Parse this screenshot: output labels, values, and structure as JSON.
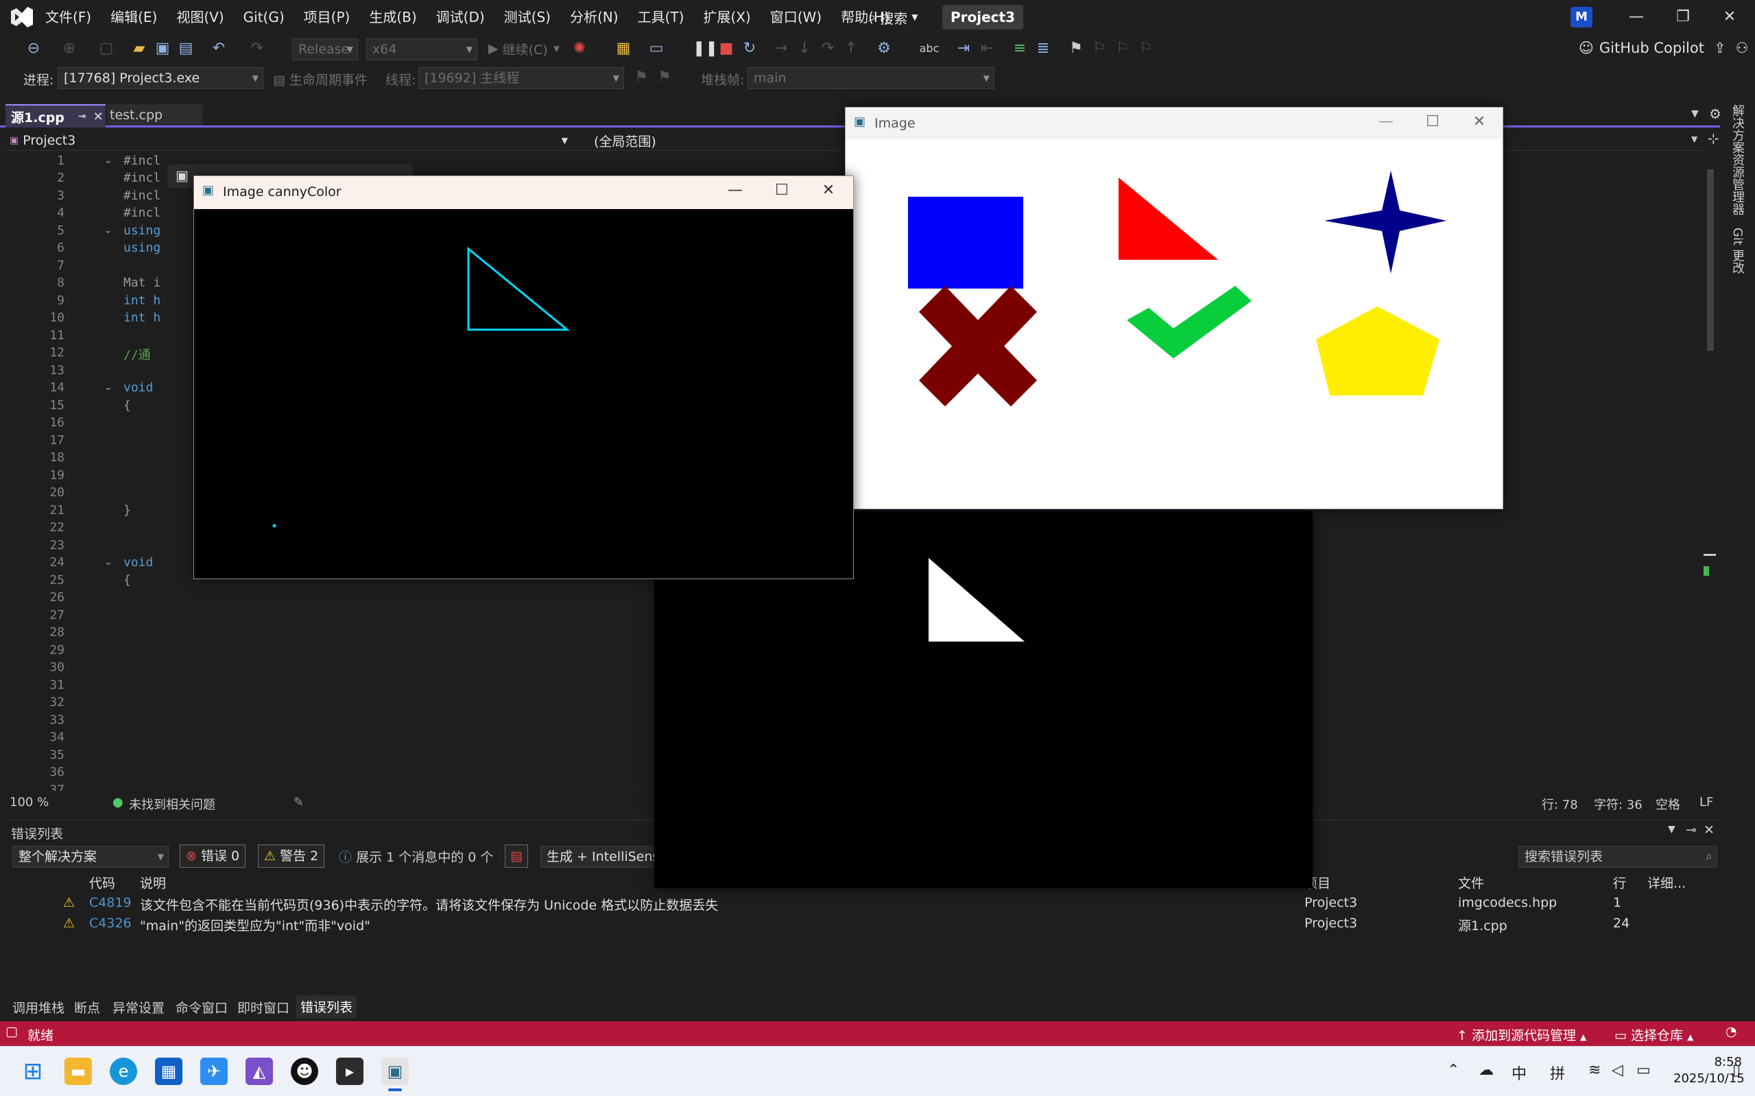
{
  "menubar": {
    "items": [
      "文件(F)",
      "编辑(E)",
      "视图(V)",
      "Git(G)",
      "项目(P)",
      "生成(B)",
      "调试(D)",
      "测试(S)",
      "分析(N)",
      "工具(T)",
      "扩展(X)",
      "窗口(W)",
      "帮助(H)"
    ],
    "search": "搜索",
    "project": "Project3",
    "avatar": "M"
  },
  "toolbar": {
    "config": "Release",
    "platform": "x64",
    "continue": "继续(C)",
    "copilot": "GitHub Copilot"
  },
  "debugbar": {
    "process_label": "进程:",
    "process_value": "[17768] Project3.exe",
    "lifecycle": "生命周期事件",
    "thread_label": "线程:",
    "thread_value": "[19692] 主线程",
    "stack_label": "堆栈帧:",
    "stack_value": "main"
  },
  "tabs": {
    "active": "源1.cpp",
    "inactive": "test.cpp"
  },
  "navbar": {
    "project": "Project3",
    "scope": "(全局范围)"
  },
  "editor": {
    "line_numbers": [
      "1",
      "2",
      "3",
      "4",
      "5",
      "6",
      "7",
      "8",
      "9",
      "10",
      "11",
      "12",
      "13",
      "14",
      "15",
      "16",
      "17",
      "18",
      "19",
      "20",
      "21",
      "22",
      "23",
      "24",
      "25",
      "26",
      "27",
      "28",
      "29",
      "30",
      "31",
      "32",
      "33",
      "34",
      "35",
      "36",
      "37"
    ],
    "code": {
      "l1": "#incl",
      "l2": "#incl",
      "l3": "#incl",
      "l4": "#incl",
      "l5": "using",
      "l6": "using",
      "l8": "Mat i",
      "l9": "int h",
      "l10": "int h",
      "l12": "//通",
      "l14": "void",
      "l15": "{",
      "l21": "}",
      "l24": "void",
      "l25": "{"
    }
  },
  "statusline": {
    "zoom": "100 %",
    "issues": "未找到相关问题",
    "row": "行: 78",
    "col": "字符: 36",
    "spaces": "空格",
    "eol": "LF"
  },
  "side_tabs": [
    "解决方案资源管理器",
    "Git 更改"
  ],
  "errorlist": {
    "title": "错误列表",
    "scope": "整个解决方案",
    "errors": "错误 0",
    "warnings": "警告 2",
    "messages": "展示 1 个消息中的 0 个",
    "build_filter": "生成 + IntelliSense",
    "search_placeholder": "搜索错误列表",
    "headers": {
      "code": "代码",
      "desc": "说明",
      "project": "项目",
      "file": "文件",
      "line": "行",
      "detail": "详细..."
    },
    "rows": [
      {
        "code": "C4819",
        "desc": "该文件包含不能在当前代码页(936)中表示的字符。请将该文件保存为 Unicode 格式以防止数据丢失",
        "project": "Project3",
        "file": "imgcodecs.hpp",
        "line": "1"
      },
      {
        "code": "C4326",
        "desc": "\"main\"的返回类型应为\"int\"而非\"void\"",
        "project": "Project3",
        "file": "源1.cpp",
        "line": "24"
      }
    ]
  },
  "bottom_tabs": [
    "调用堆栈",
    "断点",
    "异常设置",
    "命令窗口",
    "即时窗口",
    "错误列表"
  ],
  "statusbar": {
    "state": "就绪",
    "source_control": "添加到源代码管理",
    "repo": "选择仓库"
  },
  "taskbar": {
    "time": "8:58",
    "date": "2025/10/15",
    "ime1": "中",
    "ime2": "拼"
  },
  "cv_windows": {
    "image_title": "Image",
    "canny_title": "Image cannyColor"
  },
  "colors": {
    "accent": "#7160e8",
    "statusbar": "#b4173b",
    "square": "#0000ff",
    "triangle": "#ff0000",
    "star": "#00008b",
    "cross": "#800000",
    "check": "#0acd3c",
    "pentagon": "#ffee00",
    "canny_edge": "#00d8ff"
  }
}
